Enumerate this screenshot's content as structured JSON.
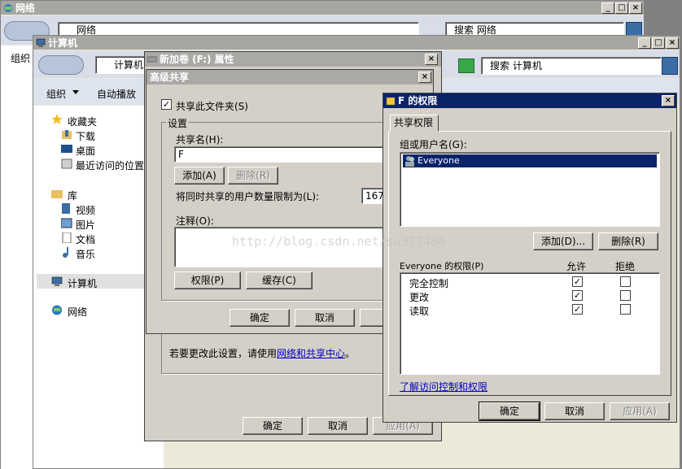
{
  "network_window": {
    "title": "网络",
    "address": "网络",
    "search_placeholder": "搜索 网络"
  },
  "computer_window": {
    "title": "计算机",
    "address": "计算机",
    "search_placeholder": "搜索 计算机",
    "toolbar": {
      "organize": "组织",
      "autoplay": "自动播放"
    },
    "sidebar": {
      "favorites": "收藏夹",
      "favorites_items": [
        "下载",
        "桌面",
        "最近访问的位置"
      ],
      "libraries": "库",
      "library_items": [
        "视频",
        "图片",
        "文档",
        "音乐"
      ],
      "computer": "计算机",
      "network": "网络"
    },
    "partial_toolbar": "组织",
    "bottom_buttons": {
      "ok": "确定",
      "cancel": "取消",
      "apply": "应用(A)"
    }
  },
  "properties_dialog": {
    "title": "新加卷 (F:) 属性",
    "footer_text": "若要更改此设置，请使用",
    "footer_link": "网络和共享中心",
    "footer_end": "。"
  },
  "advanced_sharing": {
    "title": "高级共享",
    "share_checkbox": "共享此文件夹(S)",
    "settings_group": "设置",
    "share_name_label": "共享名(H):",
    "share_name_value": "F",
    "add_button": "添加(A)",
    "remove_button": "删除(R)",
    "limit_label": "将同时共享的用户数量限制为(L):",
    "limit_value": "167",
    "comment_label": "注释(O):",
    "permissions_button": "权限(P)",
    "caching_button": "缓存(C)",
    "ok": "确定",
    "cancel": "取消"
  },
  "permissions_dialog": {
    "title": "F 的权限",
    "tab": "共享权限",
    "group_label": "组或用户名(G):",
    "users": [
      "Everyone"
    ],
    "add_button": "添加(D)...",
    "remove_button": "删除(R)",
    "perm_header": "Everyone 的权限(P)",
    "allow_header": "允许",
    "deny_header": "拒绝",
    "permissions": [
      {
        "name": "完全控制",
        "allow": true,
        "deny": false
      },
      {
        "name": "更改",
        "allow": true,
        "deny": false
      },
      {
        "name": "读取",
        "allow": true,
        "deny": false
      }
    ],
    "learn_link": "了解访问控制和权限",
    "ok": "确定",
    "cancel": "取消",
    "apply": "应用(A)"
  },
  "watermark": "http://blog.csdn.net/su377486",
  "colors": {
    "active_title": "#0a246a",
    "inactive_title": "#aaa9a6",
    "face": "#d4d0c8",
    "selection": "#0a246a"
  }
}
